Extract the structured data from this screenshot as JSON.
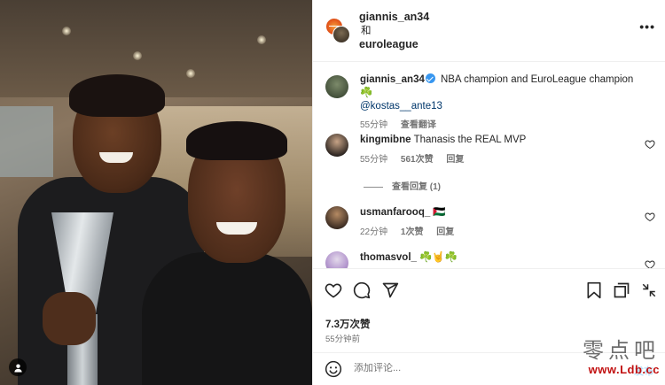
{
  "header": {
    "user1": "giannis_an34",
    "conjunction": "和",
    "user2": "euroleague",
    "more_icon": "ellipsis-icon"
  },
  "caption": {
    "user": "giannis_an34",
    "text": "NBA champion and EuroLeague champion ☘️",
    "mention": "@kostas__ante13",
    "time": "55分钟",
    "translate": "查看翻译"
  },
  "comments": [
    {
      "user": "kingmibne",
      "text": "Thanasis the REAL MVP",
      "time": "55分钟",
      "likes": "561次赞",
      "reply": "回复",
      "view_replies": "查看回复 (1)"
    },
    {
      "user": "usmanfarooq_",
      "text": "🇵🇸",
      "time": "22分钟",
      "likes": "1次赞",
      "reply": "回复"
    },
    {
      "user": "thomasvol_",
      "text": "☘️🤘☘️"
    }
  ],
  "actions": {
    "likes_count": "7.3万次赞",
    "post_time": "55分钟前",
    "comment_placeholder": "添加评论...",
    "post_button": "发布"
  },
  "watermark": {
    "chinese": "零点吧",
    "url": "www.Ldb.cc"
  },
  "colors": {
    "link": "#00376b",
    "verified": "#3897f0",
    "muted": "#737373",
    "watermark_red": "#c11010"
  }
}
